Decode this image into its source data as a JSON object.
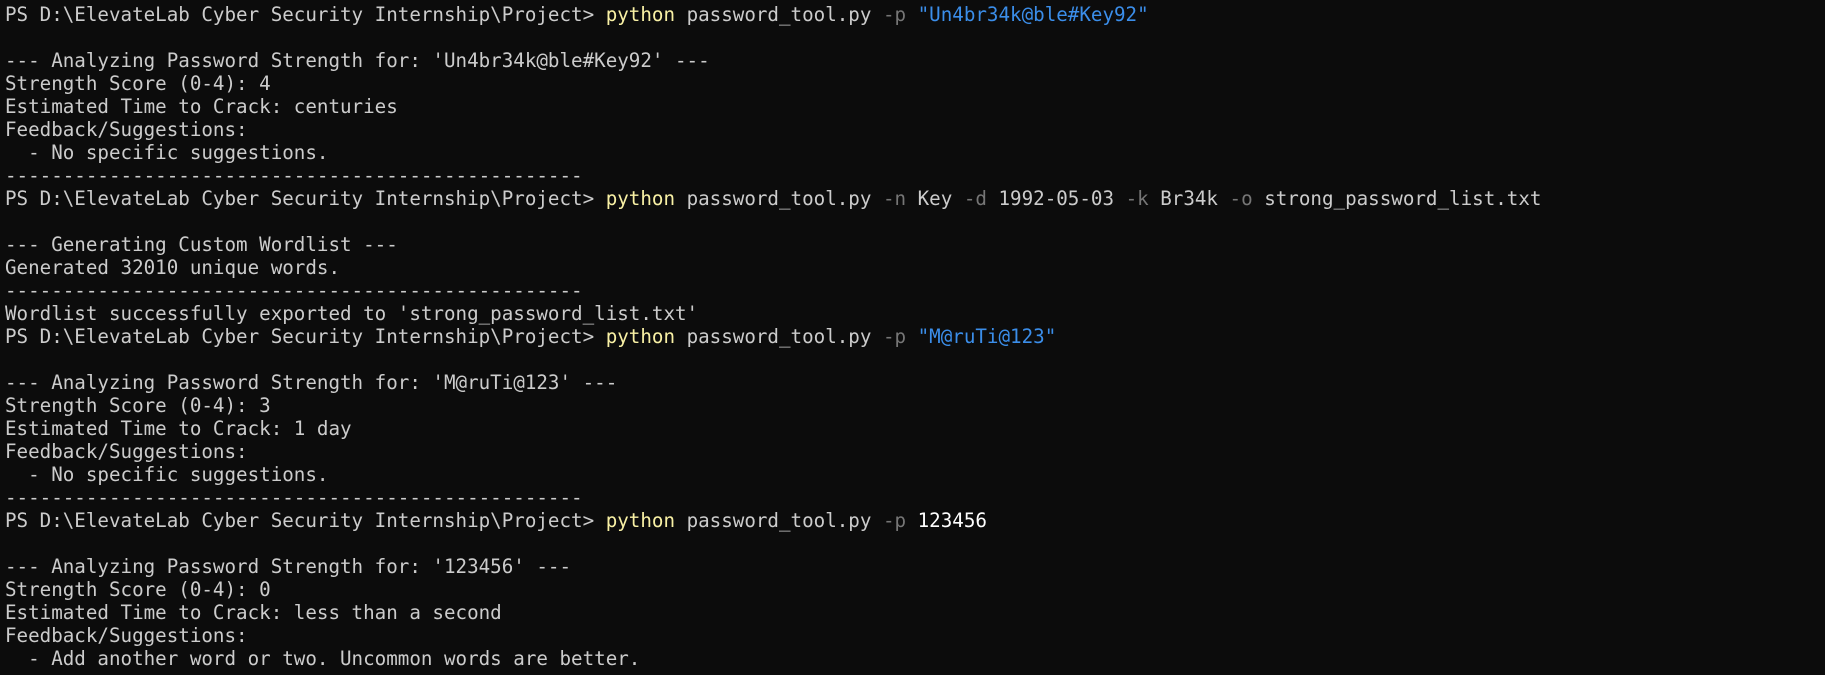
{
  "colors": {
    "background": "#0c0c0c",
    "foreground": "#cccccc",
    "command": "#f9f1a5",
    "flag": "#767676",
    "string": "#3b8eea",
    "number_arg": "#ffffff"
  },
  "prompt": "PS D:\\ElevateLab Cyber Security Internship\\Project> ",
  "lines": [
    {
      "type": "prompt",
      "segments": [
        {
          "t": "PS D:\\ElevateLab Cyber Security Internship\\Project> ",
          "c": "plain"
        },
        {
          "t": "python",
          "c": "cmd"
        },
        {
          "t": " password_tool.py ",
          "c": "plain"
        },
        {
          "t": "-p",
          "c": "flag"
        },
        {
          "t": " ",
          "c": "plain"
        },
        {
          "t": "\"Un4br34k@ble#Key92\"",
          "c": "str"
        }
      ]
    },
    {
      "type": "output",
      "text": ""
    },
    {
      "type": "output",
      "text": "--- Analyzing Password Strength for: 'Un4br34k@ble#Key92' ---"
    },
    {
      "type": "output",
      "text": "Strength Score (0-4): 4"
    },
    {
      "type": "output",
      "text": "Estimated Time to Crack: centuries"
    },
    {
      "type": "output",
      "text": "Feedback/Suggestions:"
    },
    {
      "type": "output",
      "text": "  - No specific suggestions."
    },
    {
      "type": "output",
      "text": "--------------------------------------------------"
    },
    {
      "type": "prompt",
      "segments": [
        {
          "t": "PS D:\\ElevateLab Cyber Security Internship\\Project> ",
          "c": "plain"
        },
        {
          "t": "python",
          "c": "cmd"
        },
        {
          "t": " password_tool.py ",
          "c": "plain"
        },
        {
          "t": "-n",
          "c": "flag"
        },
        {
          "t": " Key ",
          "c": "plain"
        },
        {
          "t": "-d",
          "c": "flag"
        },
        {
          "t": " 1992-05-03 ",
          "c": "plain"
        },
        {
          "t": "-k",
          "c": "flag"
        },
        {
          "t": " Br34k ",
          "c": "plain"
        },
        {
          "t": "-o",
          "c": "flag"
        },
        {
          "t": " strong_password_list.txt",
          "c": "plain"
        }
      ]
    },
    {
      "type": "output",
      "text": ""
    },
    {
      "type": "output",
      "text": "--- Generating Custom Wordlist ---"
    },
    {
      "type": "output",
      "text": "Generated 32010 unique words."
    },
    {
      "type": "output",
      "text": "--------------------------------------------------"
    },
    {
      "type": "output",
      "text": "Wordlist successfully exported to 'strong_password_list.txt'"
    },
    {
      "type": "prompt",
      "segments": [
        {
          "t": "PS D:\\ElevateLab Cyber Security Internship\\Project> ",
          "c": "plain"
        },
        {
          "t": "python",
          "c": "cmd"
        },
        {
          "t": " password_tool.py ",
          "c": "plain"
        },
        {
          "t": "-p",
          "c": "flag"
        },
        {
          "t": " ",
          "c": "plain"
        },
        {
          "t": "\"M@ruTi@123\"",
          "c": "str"
        }
      ]
    },
    {
      "type": "output",
      "text": ""
    },
    {
      "type": "output",
      "text": "--- Analyzing Password Strength for: 'M@ruTi@123' ---"
    },
    {
      "type": "output",
      "text": "Strength Score (0-4): 3"
    },
    {
      "type": "output",
      "text": "Estimated Time to Crack: 1 day"
    },
    {
      "type": "output",
      "text": "Feedback/Suggestions:"
    },
    {
      "type": "output",
      "text": "  - No specific suggestions."
    },
    {
      "type": "output",
      "text": "--------------------------------------------------"
    },
    {
      "type": "prompt",
      "segments": [
        {
          "t": "PS D:\\ElevateLab Cyber Security Internship\\Project> ",
          "c": "plain"
        },
        {
          "t": "python",
          "c": "cmd"
        },
        {
          "t": " password_tool.py ",
          "c": "plain"
        },
        {
          "t": "-p",
          "c": "flag"
        },
        {
          "t": " ",
          "c": "plain"
        },
        {
          "t": "123456",
          "c": "argnum"
        }
      ]
    },
    {
      "type": "output",
      "text": ""
    },
    {
      "type": "output",
      "text": "--- Analyzing Password Strength for: '123456' ---"
    },
    {
      "type": "output",
      "text": "Strength Score (0-4): 0"
    },
    {
      "type": "output",
      "text": "Estimated Time to Crack: less than a second"
    },
    {
      "type": "output",
      "text": "Feedback/Suggestions:"
    },
    {
      "type": "output",
      "text": "  - Add another word or two. Uncommon words are better."
    }
  ]
}
